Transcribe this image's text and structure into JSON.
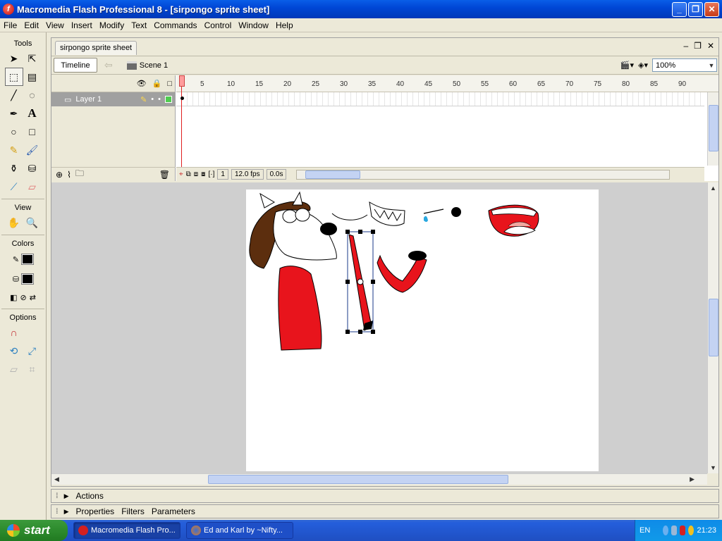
{
  "window": {
    "title": "Macromedia Flash Professional 8 - [sirpongo sprite sheet]"
  },
  "menu": [
    "File",
    "Edit",
    "View",
    "Insert",
    "Modify",
    "Text",
    "Commands",
    "Control",
    "Window",
    "Help"
  ],
  "tools_panel": {
    "header": "Tools",
    "view_label": "View",
    "colors_label": "Colors",
    "options_label": "Options"
  },
  "document": {
    "tab": "sirpongo sprite sheet",
    "timeline_button": "Timeline",
    "scene": "Scene 1",
    "zoom": "100%"
  },
  "timeline": {
    "layer_name": "Layer 1",
    "ruler": [
      "1",
      "5",
      "10",
      "15",
      "20",
      "25",
      "30",
      "35",
      "40",
      "45",
      "50",
      "55",
      "60",
      "65",
      "70",
      "75",
      "80",
      "85",
      "90"
    ],
    "current_frame": "1",
    "frame_rate": "12.0 fps",
    "elapsed": "0.0s"
  },
  "panels": {
    "actions": "Actions",
    "properties": "Properties",
    "filters": "Filters",
    "parameters": "Parameters"
  },
  "taskbar": {
    "start": "start",
    "tasks": [
      "Macromedia Flash Pro...",
      "Ed and Karl by ~Nifty..."
    ],
    "lang": "EN",
    "clock": "21:23"
  },
  "colors": {
    "accent_red": "#e8141c",
    "hair_brown": "#5c2e0e",
    "layer_green": "#4fcc4f",
    "tear_blue": "#29a8e0"
  }
}
